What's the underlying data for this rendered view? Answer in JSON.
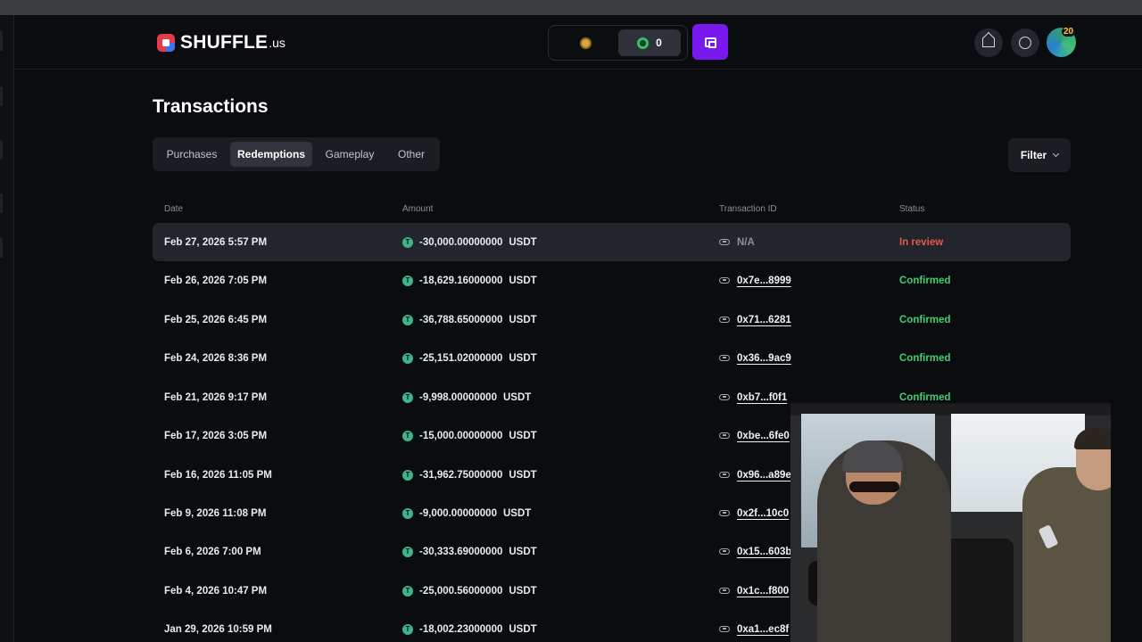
{
  "brand": {
    "name": "SHUFFLE",
    "tld": ".us"
  },
  "header": {
    "gold_coin_balance": "",
    "sweep_coin_balance": "0",
    "avatar_level": "20",
    "icons": [
      "gold-coin-icon",
      "sweep-coin-icon",
      "wallet-icon",
      "crown-icon",
      "chat-icon"
    ]
  },
  "page": {
    "title": "Transactions"
  },
  "tabs": [
    {
      "label": "Purchases",
      "active": false
    },
    {
      "label": "Redemptions",
      "active": true
    },
    {
      "label": "Gameplay",
      "active": false
    },
    {
      "label": "Other",
      "active": false
    }
  ],
  "filter": {
    "label": "Filter"
  },
  "table": {
    "headers": {
      "date": "Date",
      "amount": "Amount",
      "txid": "Transaction ID",
      "status": "Status"
    },
    "rows": [
      {
        "date": "Feb 27, 2026 5:57 PM",
        "amount": "-30,000.00000000",
        "currency": "USDT",
        "txid": "N/A",
        "status": "In review"
      },
      {
        "date": "Feb 26, 2026 7:05 PM",
        "amount": "-18,629.16000000",
        "currency": "USDT",
        "txid": "0x7e...8999",
        "status": "Confirmed"
      },
      {
        "date": "Feb 25, 2026 6:45 PM",
        "amount": "-36,788.65000000",
        "currency": "USDT",
        "txid": "0x71...6281",
        "status": "Confirmed"
      },
      {
        "date": "Feb 24, 2026 8:36 PM",
        "amount": "-25,151.02000000",
        "currency": "USDT",
        "txid": "0x36...9ac9",
        "status": "Confirmed"
      },
      {
        "date": "Feb 21, 2026 9:17 PM",
        "amount": "-9,998.00000000",
        "currency": "USDT",
        "txid": "0xb7...f0f1",
        "status": "Confirmed"
      },
      {
        "date": "Feb 17, 2026 3:05 PM",
        "amount": "-15,000.00000000",
        "currency": "USDT",
        "txid": "0xbe...6fe0",
        "status": ""
      },
      {
        "date": "Feb 16, 2026 11:05 PM",
        "amount": "-31,962.75000000",
        "currency": "USDT",
        "txid": "0x96...a89e",
        "status": ""
      },
      {
        "date": "Feb 9, 2026 11:08 PM",
        "amount": "-9,000.00000000",
        "currency": "USDT",
        "txid": "0x2f...10c0",
        "status": ""
      },
      {
        "date": "Feb 6, 2026 7:00 PM",
        "amount": "-30,333.69000000",
        "currency": "USDT",
        "txid": "0x15...603b",
        "status": ""
      },
      {
        "date": "Feb 4, 2026 10:47 PM",
        "amount": "-25,000.56000000",
        "currency": "USDT",
        "txid": "0x1c...f800",
        "status": ""
      },
      {
        "date": "Jan 29, 2026 10:59 PM",
        "amount": "-18,002.23000000",
        "currency": "USDT",
        "txid": "0xa1...ec8f",
        "status": ""
      }
    ]
  },
  "colors": {
    "accent": "#7a18f0",
    "status_review": "#e5584a",
    "status_confirmed": "#3fd073",
    "usdt": "#3db58a"
  }
}
